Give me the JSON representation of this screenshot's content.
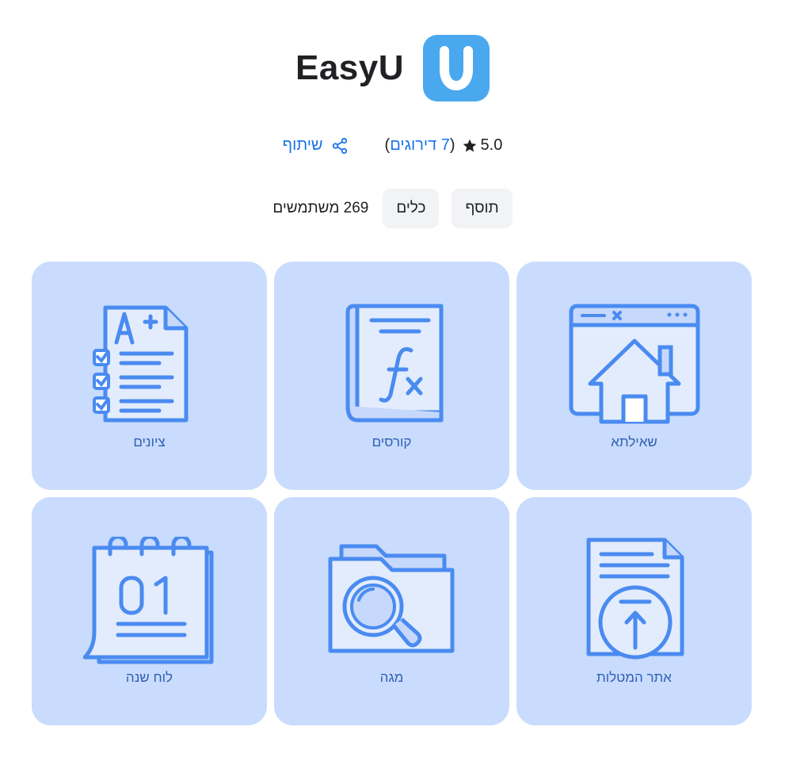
{
  "app": {
    "name": "EasyU",
    "logo_letter": "U",
    "logo_color": "#4aa8ef"
  },
  "rating": {
    "value": "5.0",
    "star_icon": "star-icon",
    "reviews_link": "7 דירוגים",
    "open_paren": "(",
    "close_paren": ")",
    "share_label": "שיתוף",
    "share_icon": "share-icon"
  },
  "chips": [
    "תוסף",
    "כלים"
  ],
  "users_count": "269 משתמשים",
  "tiles": [
    {
      "label": "שאילתא",
      "icon": "browser-home-icon"
    },
    {
      "label": "קורסים",
      "icon": "formula-book-icon"
    },
    {
      "label": "ציונים",
      "icon": "grades-checklist-icon"
    },
    {
      "label": "אתר המטלות",
      "icon": "upload-document-icon"
    },
    {
      "label": "מגה",
      "icon": "folder-search-icon"
    },
    {
      "label": "לוח שנה",
      "icon": "calendar-icon"
    }
  ],
  "colors": {
    "tile_bg": "#c9dcfd",
    "icon_stroke": "#4a8bf0",
    "link": "#1a73e8"
  }
}
